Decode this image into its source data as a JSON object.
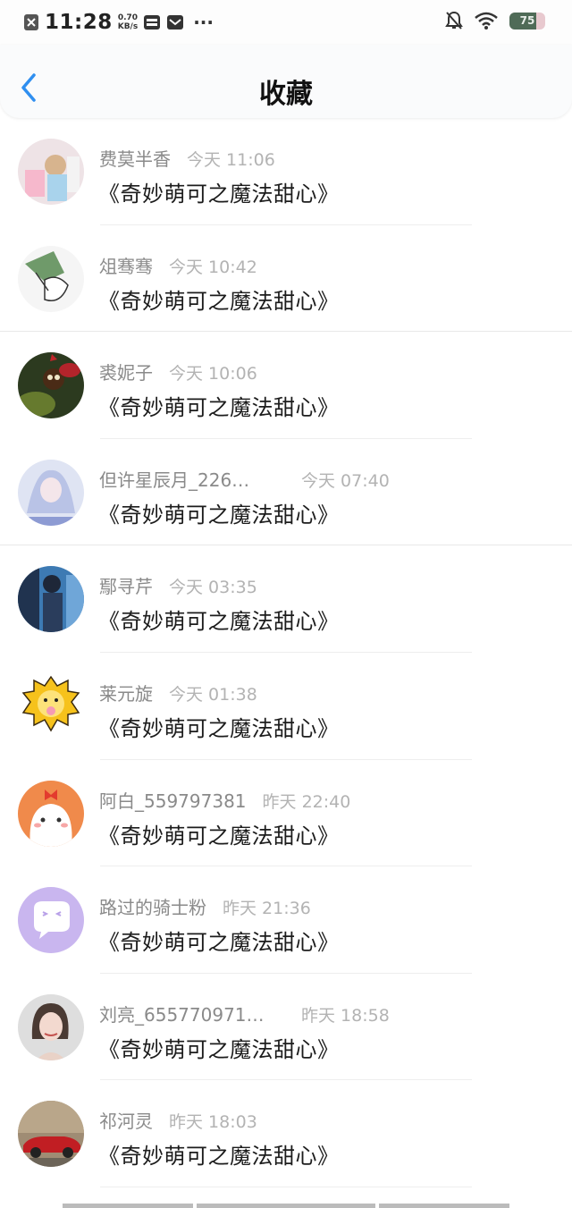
{
  "status_bar": {
    "time": "11:28",
    "net_speed_value": "0.70",
    "net_speed_unit": "KB/s",
    "more": "···",
    "battery": "75",
    "battery_level": 0.75
  },
  "header": {
    "title": "收藏"
  },
  "items": [
    {
      "name": "费莫半香",
      "time": "今天 11:06",
      "work": "《奇妙萌可之魔法甜心》"
    },
    {
      "name": "俎骞骞",
      "time": "今天 10:42",
      "work": "《奇妙萌可之魔法甜心》"
    },
    {
      "name": "裘妮子",
      "time": "今天 10:06",
      "work": "《奇妙萌可之魔法甜心》"
    },
    {
      "name": "但许星辰月_226…",
      "time": "今天 07:40",
      "work": "《奇妙萌可之魔法甜心》"
    },
    {
      "name": "鄢寻芹",
      "time": "今天 03:35",
      "work": "《奇妙萌可之魔法甜心》"
    },
    {
      "name": "莱元旋",
      "time": "今天 01:38",
      "work": "《奇妙萌可之魔法甜心》"
    },
    {
      "name": "阿白_559797381",
      "time": "昨天 22:40",
      "work": "《奇妙萌可之魔法甜心》"
    },
    {
      "name": "路过的骑士粉",
      "time": "昨天 21:36",
      "work": "《奇妙萌可之魔法甜心》"
    },
    {
      "name": "刘亮_655770971…",
      "time": "昨天 18:58",
      "work": "《奇妙萌可之魔法甜心》"
    },
    {
      "name": "祁河灵",
      "time": "昨天 18:03",
      "work": "《奇妙萌可之魔法甜心》"
    }
  ],
  "colors": {
    "accent": "#2f8ff0",
    "name_gray": "#8a8a8a",
    "time_gray": "#b3b3b3"
  }
}
